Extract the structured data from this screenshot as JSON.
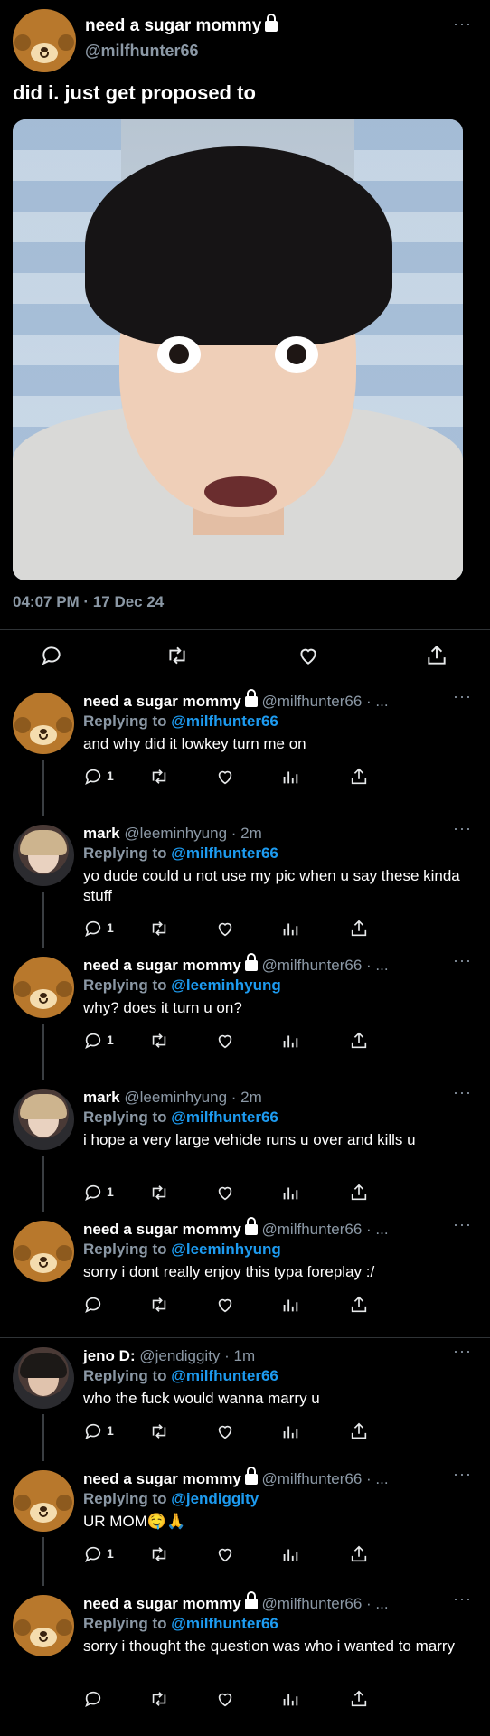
{
  "main_tweet": {
    "display_name": "need a sugar mommy",
    "handle": "@milfhunter66",
    "text": "did i. just get proposed to",
    "timestamp": "04:07 PM · 17 Dec 24",
    "more": "···"
  },
  "replies": [
    {
      "display_name": "need a sugar mommy",
      "handle": "@milfhunter66 · ...",
      "replying_label": "Replying to",
      "replying_to": "@milfhunter66",
      "text": "and why did it lowkey turn me on",
      "reply_count": "1",
      "avatar": "bear"
    },
    {
      "display_name": "mark",
      "handle": "@leeminhyung · 2m",
      "replying_label": "Replying to",
      "replying_to": "@milfhunter66",
      "text": "yo dude could u not use my pic when u say these kinda stuff",
      "reply_count": "1",
      "avatar": "person-blonde"
    },
    {
      "display_name": "need a sugar mommy",
      "handle": "@milfhunter66 · ...",
      "replying_label": "Replying to",
      "replying_to": "@leeminhyung",
      "text": "why? does it turn u on?",
      "reply_count": "1",
      "avatar": "bear"
    },
    {
      "display_name": "mark",
      "handle": "@leeminhyung · 2m",
      "replying_label": "Replying to",
      "replying_to": "@milfhunter66",
      "text": "i hope a very large vehicle runs u over and kills u",
      "reply_count": "1",
      "avatar": "person-blonde"
    },
    {
      "display_name": "need a sugar mommy",
      "handle": "@milfhunter66 · ...",
      "replying_label": "Replying to",
      "replying_to": "@leeminhyung",
      "text": "sorry i dont really enjoy this typa foreplay :/",
      "reply_count": "",
      "avatar": "bear"
    },
    {
      "display_name": "jeno D:",
      "handle": "@jendiggity · 1m",
      "replying_label": "Replying to",
      "replying_to": "@milfhunter66",
      "text": "who the fuck would wanna marry u",
      "reply_count": "1",
      "avatar": "person-dark"
    },
    {
      "display_name": "need a sugar mommy",
      "handle": "@milfhunter66 · ...",
      "replying_label": "Replying to",
      "replying_to": "@jendiggity",
      "text": "UR MOM🤤🙏",
      "reply_count": "1",
      "avatar": "bear"
    },
    {
      "display_name": "need a sugar mommy",
      "handle": "@milfhunter66 · ...",
      "replying_label": "Replying to",
      "replying_to": "@milfhunter66",
      "text": "sorry i thought the question was who i wanted to marry",
      "reply_count": "",
      "avatar": "bear"
    }
  ],
  "icons": {
    "reply": "reply-icon",
    "retweet": "retweet-icon",
    "like": "heart-icon",
    "views": "views-icon",
    "share": "share-icon",
    "lock": "lock-icon"
  },
  "colors": {
    "background": "#000000",
    "mention": "#1d9bf0",
    "secondary": "#8b98a5"
  }
}
